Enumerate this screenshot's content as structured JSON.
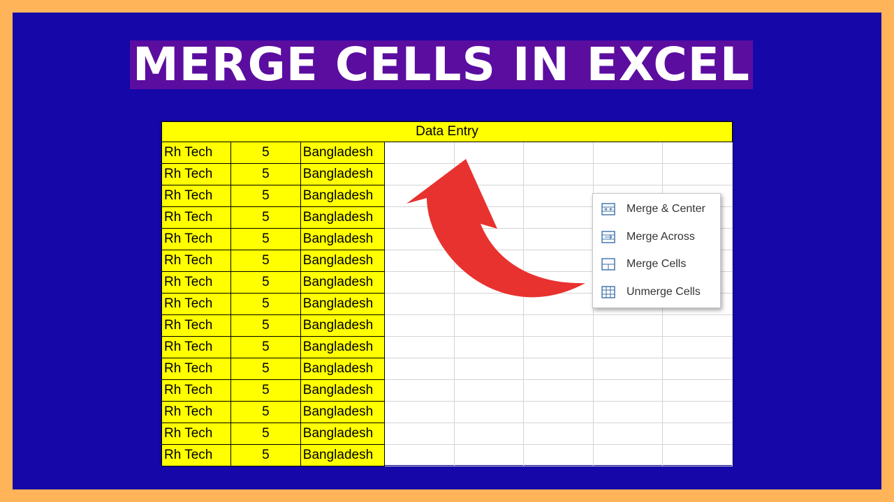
{
  "title": "MERGE CELLS IN EXCEL",
  "sheet": {
    "header": "Data Entry",
    "rows": [
      [
        "Rh Tech",
        "5",
        "Bangladesh"
      ],
      [
        "Rh Tech",
        "5",
        "Bangladesh"
      ],
      [
        "Rh Tech",
        "5",
        "Bangladesh"
      ],
      [
        "Rh Tech",
        "5",
        "Bangladesh"
      ],
      [
        "Rh Tech",
        "5",
        "Bangladesh"
      ],
      [
        "Rh Tech",
        "5",
        "Bangladesh"
      ],
      [
        "Rh Tech",
        "5",
        "Bangladesh"
      ],
      [
        "Rh Tech",
        "5",
        "Bangladesh"
      ],
      [
        "Rh Tech",
        "5",
        "Bangladesh"
      ],
      [
        "Rh Tech",
        "5",
        "Bangladesh"
      ],
      [
        "Rh Tech",
        "5",
        "Bangladesh"
      ],
      [
        "Rh Tech",
        "5",
        "Bangladesh"
      ],
      [
        "Rh Tech",
        "5",
        "Bangladesh"
      ],
      [
        "Rh Tech",
        "5",
        "Bangladesh"
      ],
      [
        "Rh Tech",
        "5",
        "Bangladesh"
      ]
    ]
  },
  "menu": {
    "items": [
      {
        "label": "Merge & Center",
        "icon": "merge-center-icon"
      },
      {
        "label": "Merge Across",
        "icon": "merge-across-icon"
      },
      {
        "label": "Merge Cells",
        "icon": "merge-cells-icon"
      },
      {
        "label": "Unmerge Cells",
        "icon": "unmerge-cells-icon"
      }
    ]
  },
  "colors": {
    "background": "#FFB45A",
    "frame": "#1507A8",
    "title_bg": "#5B0DA0",
    "highlight": "#FFFF00",
    "arrow": "#E8322F",
    "icon": "#3A6FA8"
  }
}
